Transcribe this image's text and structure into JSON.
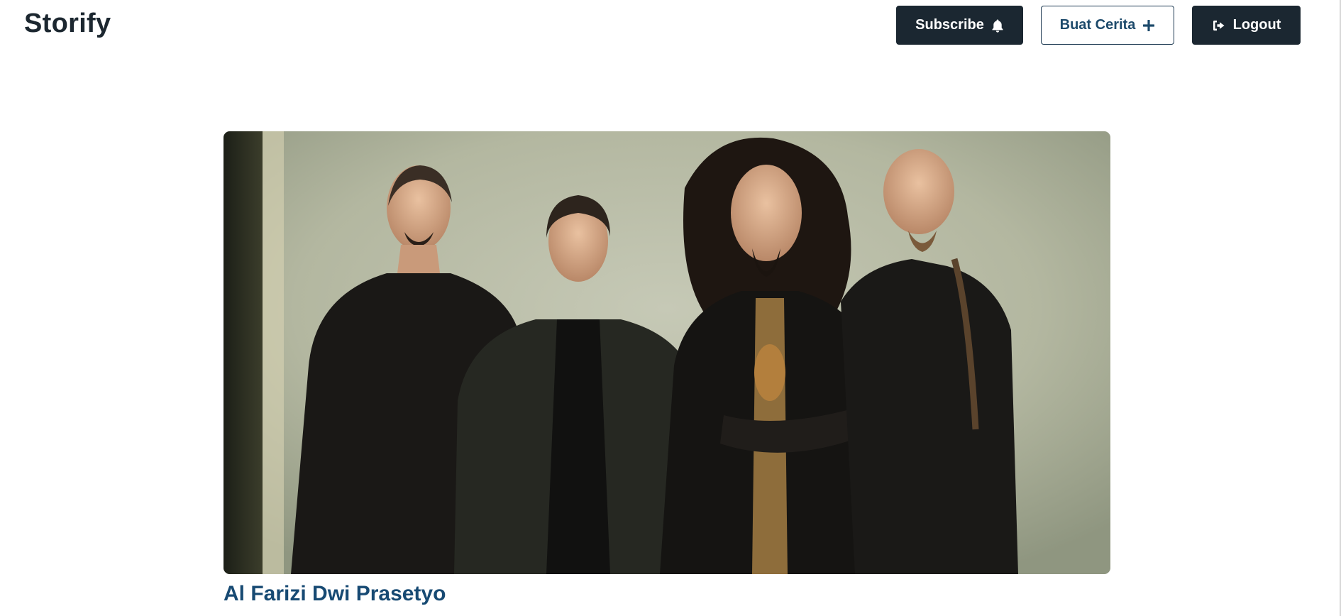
{
  "app": {
    "brand": "Storify"
  },
  "nav": {
    "subscribe_label": "Subscribe",
    "subscribe_icon": "bell-icon",
    "create_label": "Buat Cerita",
    "create_icon": "plus-icon",
    "logout_label": "Logout",
    "logout_icon": "sign-out-icon"
  },
  "story": {
    "image_alt": "story photo",
    "author": "Al Farizi Dwi Prasetyo"
  },
  "colors": {
    "primary_dark": "#1b2731",
    "accent_blue": "#174a73",
    "background": "#ffffff"
  }
}
